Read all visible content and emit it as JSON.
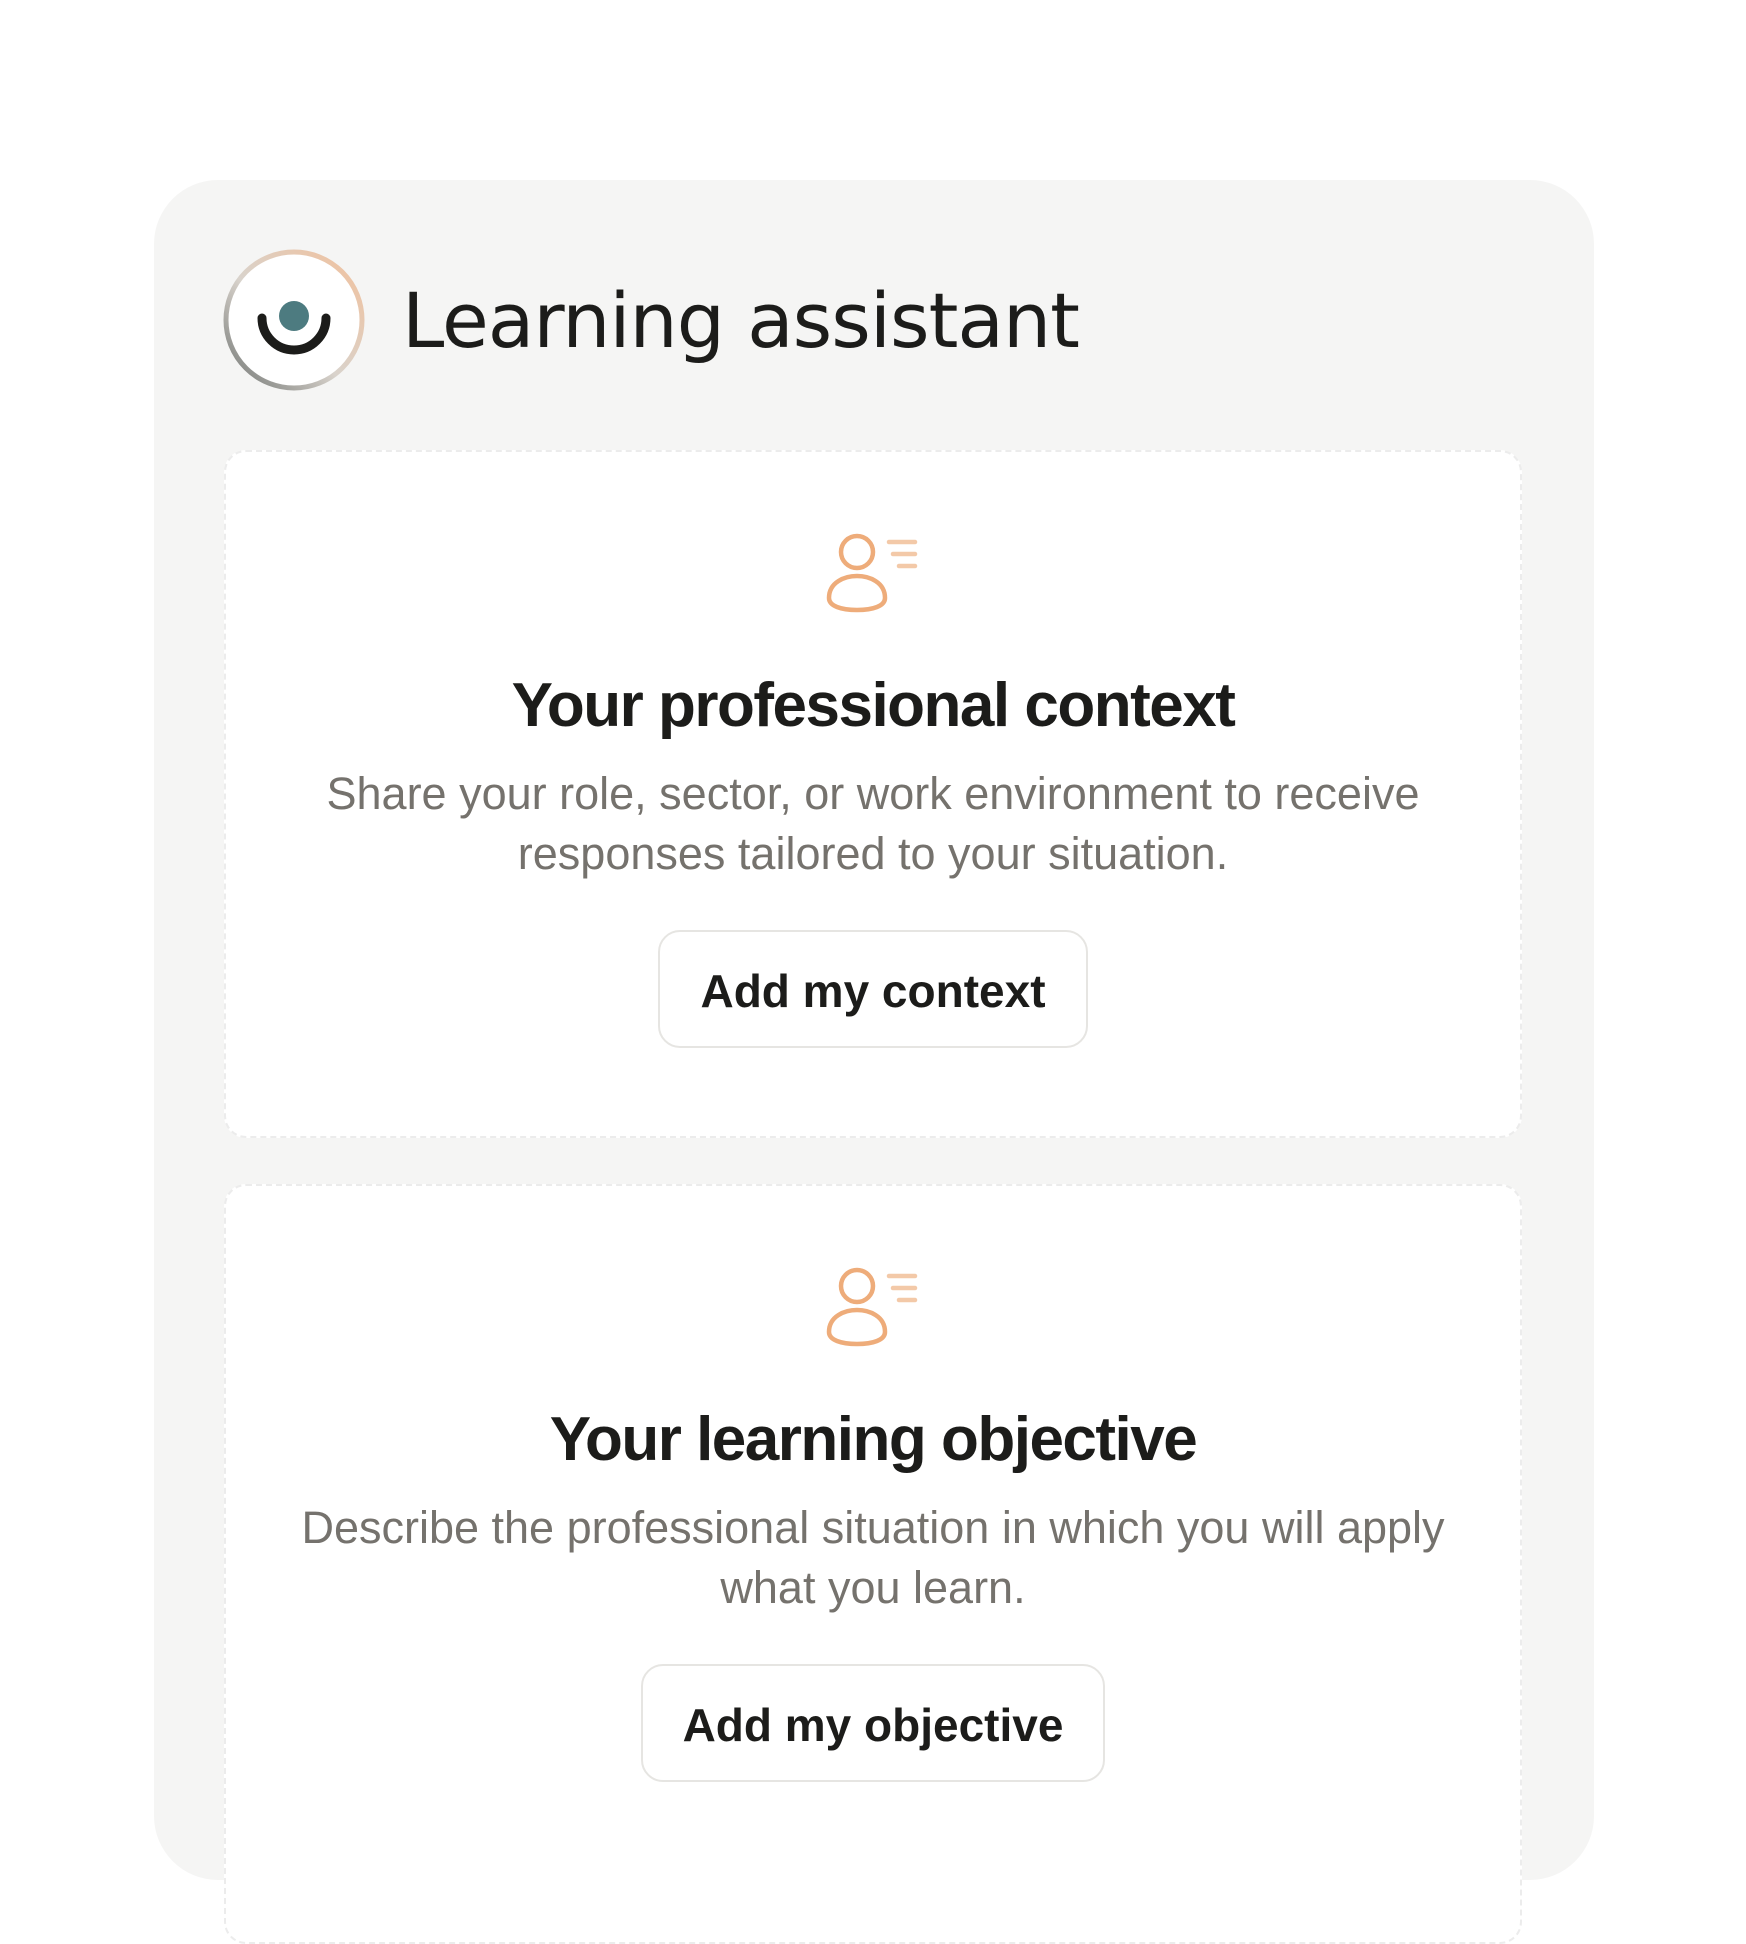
{
  "assistant": {
    "title": "Learning assistant",
    "logo_icon": "smile-eye-icon",
    "logo_colors": {
      "ring_start": "#f2c09b",
      "ring_end": "#6f7472",
      "dot": "#4d7b80",
      "smile": "#1c1c1a"
    }
  },
  "cards": [
    {
      "icon": "user-profile-icon",
      "title": "Your professional context",
      "description": "Share your role, sector, or work environment to receive responses tailored to your situation.",
      "button_label": "Add my context"
    },
    {
      "icon": "user-profile-icon",
      "title": "Your learning objective",
      "description": "Describe the professional situation in which you will apply what you learn.",
      "button_label": "Add my objective"
    }
  ],
  "colors": {
    "accent": "#eeac7a",
    "panel_bg": "#f5f5f4",
    "text_primary": "#1c1c1a",
    "text_secondary": "#75726d"
  }
}
